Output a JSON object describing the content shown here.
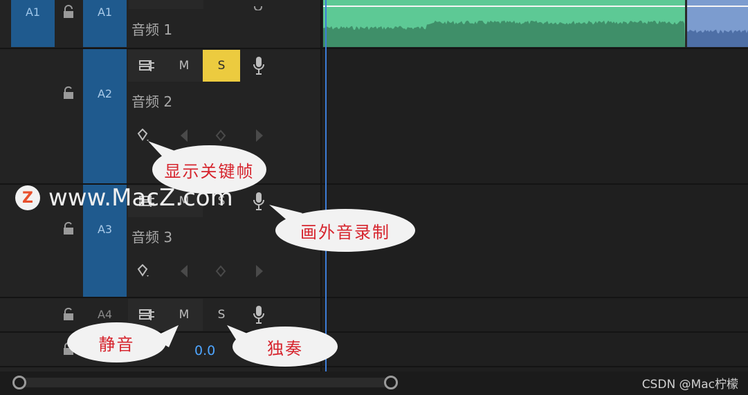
{
  "tracks": {
    "a1": {
      "source_patch": "A1",
      "target": "A1",
      "name": "音频 1"
    },
    "a2": {
      "target": "A2",
      "name": "音频 2",
      "mute_label": "M",
      "solo_label": "S"
    },
    "a3": {
      "target": "A3",
      "name": "音频 3",
      "mute_label": "M",
      "solo_label": "S"
    },
    "a4": {
      "target": "A4",
      "mute_label": "M",
      "solo_label": "S"
    }
  },
  "master": {
    "volume": "0.0"
  },
  "callouts": {
    "show_keyframes": "显示关键帧",
    "voiceover_record": "画外音录制",
    "mute": "静音",
    "solo": "独奏"
  },
  "watermark": {
    "logo_letter": "Z",
    "text": "www.MacZ.com"
  },
  "credit": "CSDN @Mac柠檬",
  "colors": {
    "solo_active": "#eccb3f",
    "track_target": "#1f5a8e",
    "audio_clip": "#5dc995",
    "audio_clip_alt": "#7c9ccf",
    "playhead": "#3d7dd8",
    "callout_text": "#d6242d"
  },
  "icons": [
    "lock-icon",
    "sync-lock-icon",
    "microphone-icon",
    "keyframe-toggle-icon",
    "prev-keyframe-icon",
    "add-keyframe-icon",
    "next-keyframe-icon"
  ]
}
